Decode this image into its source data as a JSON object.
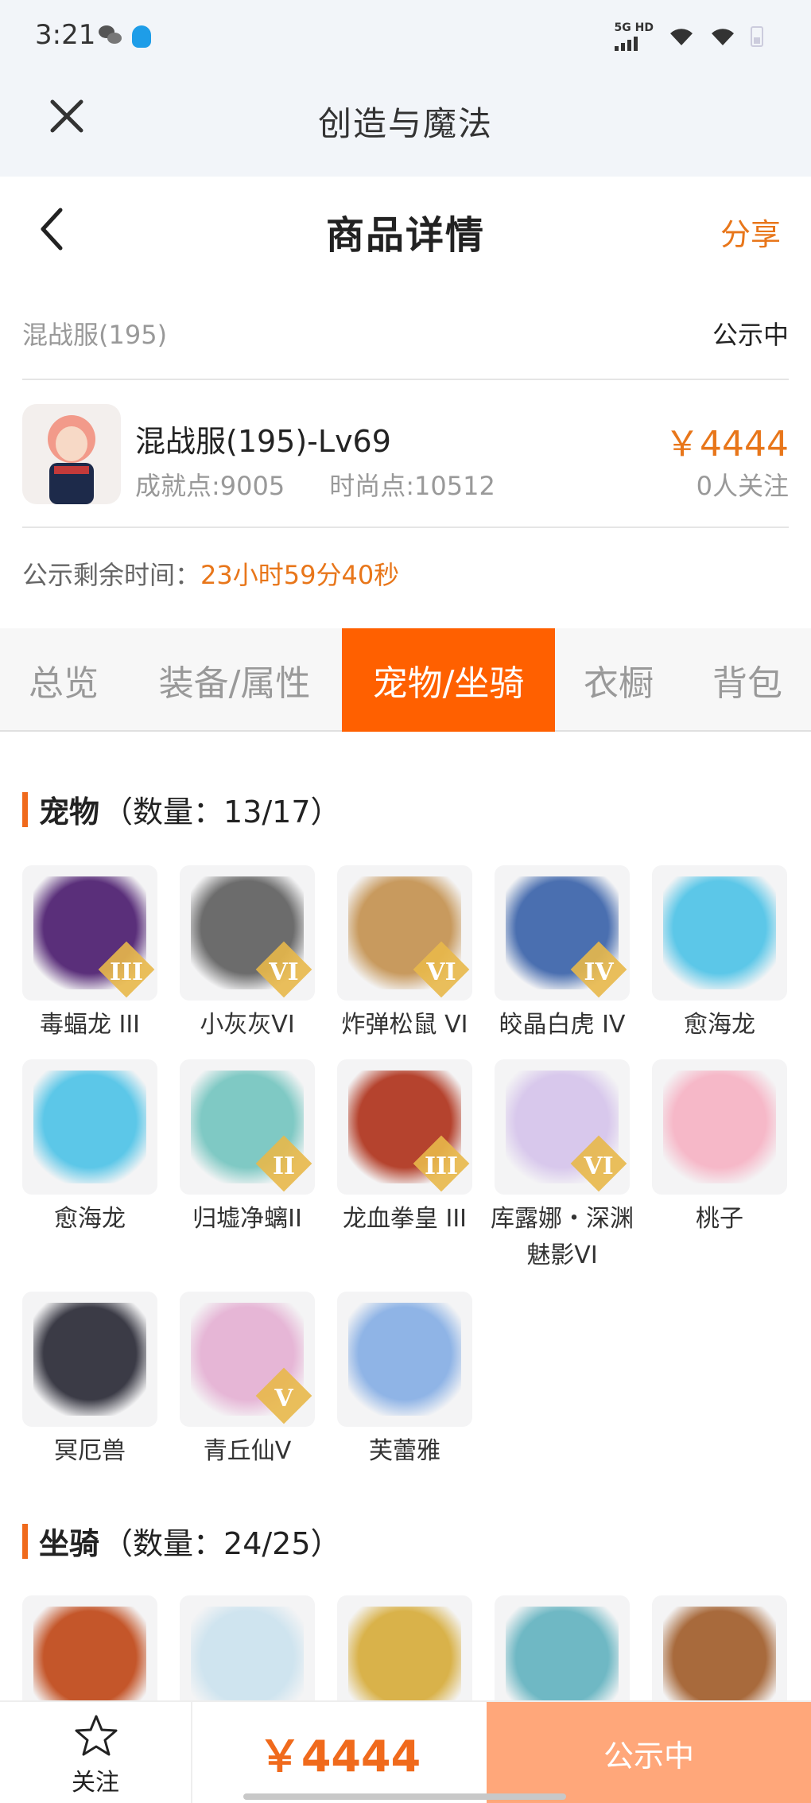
{
  "status_bar": {
    "time": "3:21",
    "network": "5G HD"
  },
  "app_bar": {
    "title": "创造与魔法"
  },
  "header": {
    "title": "商品详情",
    "share": "分享"
  },
  "server": {
    "name": "混战服(195)",
    "status": "公示中"
  },
  "character": {
    "name": "混战服(195)-Lv69",
    "achievement": "成就点:9005",
    "fashion": "时尚点:10512",
    "price": "￥4444",
    "followers": "0人关注"
  },
  "remaining": {
    "label": "公示剩余时间：",
    "value": "23小时59分40秒"
  },
  "tabs": [
    {
      "label": "总览"
    },
    {
      "label": "装备/属性"
    },
    {
      "label": "宠物/坐骑",
      "active": true
    },
    {
      "label": "衣橱"
    },
    {
      "label": "背包"
    }
  ],
  "pets": {
    "title": "宠物",
    "count": "（数量：13/17）",
    "items": [
      {
        "name": "毒蝠龙 III",
        "badge": "III",
        "color": "#5a2f7a"
      },
      {
        "name": "小灰灰VI",
        "badge": "VI",
        "color": "#6c6c6c"
      },
      {
        "name": "炸弹松鼠 VI",
        "badge": "VI",
        "color": "#c89a5e"
      },
      {
        "name": "皎晶白虎 IV",
        "badge": "IV",
        "color": "#4a6fb0"
      },
      {
        "name": "愈海龙",
        "badge": "",
        "color": "#5cc7e8"
      },
      {
        "name": "愈海龙",
        "badge": "",
        "color": "#5cc7e8"
      },
      {
        "name": "归墟净螭II",
        "badge": "II",
        "color": "#7fc9c4"
      },
      {
        "name": "龙血拳皇 III",
        "badge": "III",
        "color": "#b5432e"
      },
      {
        "name": "库露娜・深渊魅影VI",
        "badge": "VI",
        "color": "#d8c8ec"
      },
      {
        "name": "桃子",
        "badge": "",
        "color": "#f6b8c8"
      },
      {
        "name": "冥厄兽",
        "badge": "",
        "color": "#3b3b46"
      },
      {
        "name": "青丘仙V",
        "badge": "V",
        "color": "#e6b6d6"
      },
      {
        "name": "芙蕾雅",
        "badge": "",
        "color": "#8fb4e6"
      }
    ]
  },
  "mounts": {
    "title": "坐骑",
    "count": "（数量：24/25）",
    "items": [
      {
        "name": "",
        "color": "#c4562a"
      },
      {
        "name": "",
        "color": "#cfe4ef"
      },
      {
        "name": "",
        "color": "#d9b24a"
      },
      {
        "name": "",
        "color": "#6fb8c4"
      },
      {
        "name": "",
        "color": "#a86a3c"
      }
    ]
  },
  "bottom_bar": {
    "follow": "关注",
    "price": "￥4444",
    "status": "公示中"
  }
}
